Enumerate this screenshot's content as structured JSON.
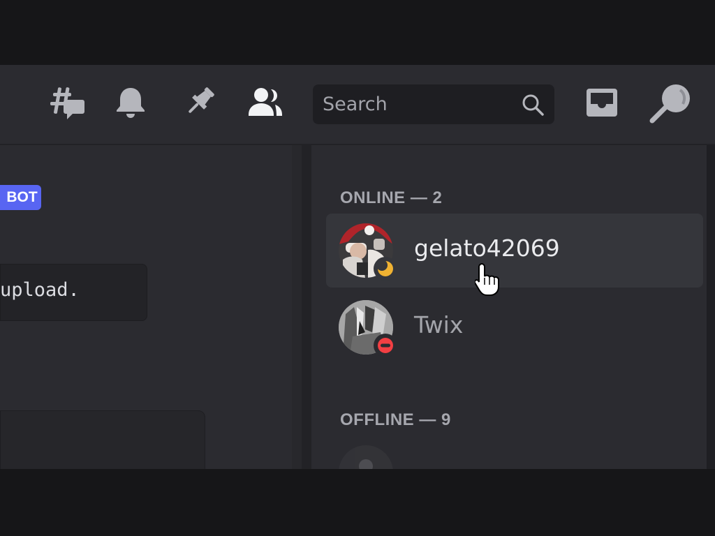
{
  "header": {
    "icons": [
      "threads-icon",
      "bell-icon",
      "pin-icon",
      "members-icon",
      "inbox-icon",
      "help-icon"
    ],
    "search_placeholder": "Search"
  },
  "chat": {
    "bot_badge": "BOT",
    "code_text": "upload."
  },
  "members": {
    "online_header": "ONLINE — 2",
    "offline_header": "OFFLINE — 9",
    "online": [
      {
        "name": "gelato42069",
        "status": "idle",
        "hovered": true
      },
      {
        "name": "Twix",
        "status": "dnd",
        "hovered": false
      }
    ]
  },
  "colors": {
    "accent": "#5865f2",
    "idle": "#f0b232",
    "dnd": "#f23f43"
  }
}
